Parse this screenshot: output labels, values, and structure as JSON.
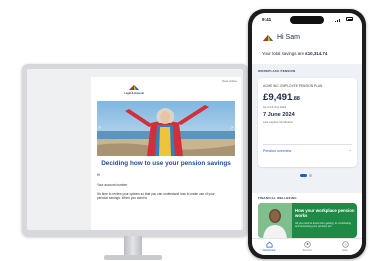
{
  "email": {
    "top_link": "View online",
    "logo_text": "Legal & General",
    "heading": "Deciding how to use your pension savings",
    "greeting": "Hi",
    "account_line": "Your account number",
    "body": "It's time to review your options so that you can understand how to make use of your pension savings. When you want to"
  },
  "phone": {
    "time": "9:41",
    "greeting": "Hi Sam",
    "savings_prefix": "Your total savings are ",
    "savings_total": "£10,314.74",
    "workplace_label": "WORKPLACE PENSION",
    "plan": {
      "name": "ACME INC. EMPLOYEE PENSION PLAN",
      "amount_pounds": "£9,491",
      "amount_pence": ".88",
      "as_of": "As of 14 July 2024",
      "date": "7 June 2024",
      "contribution_label": "Last regular contribution",
      "overview_link": "Pension overview",
      "overview_arrow": "→"
    },
    "financial_label": "FINANCIAL WELLBEING",
    "wellbeing": {
      "title": "How your workplace pension works",
      "description": "All you need to know from getting, to contributing and accessing your pension pot"
    },
    "tabs": [
      {
        "label": "Dashboard",
        "icon": "home-icon",
        "active": true
      },
      {
        "label": "Account",
        "icon": "profile-icon",
        "active": false
      },
      {
        "label": "Help",
        "icon": "help-icon",
        "active": false
      }
    ]
  },
  "colors": {
    "brand_blue": "#1d5cc9",
    "heading_blue": "#1d4c9e",
    "wellbeing_green": "#1f8a45",
    "navy_text": "#1f2a44"
  }
}
